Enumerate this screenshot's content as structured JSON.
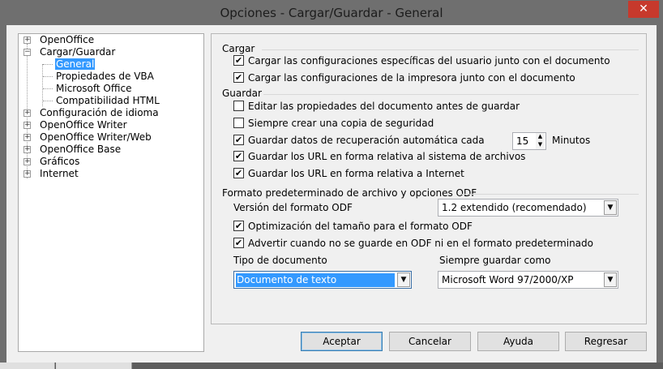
{
  "window": {
    "title": "Opciones - Cargar/Guardar - General",
    "close_glyph": "✕"
  },
  "tree": {
    "items": [
      {
        "label": "OpenOffice",
        "expander": "+"
      },
      {
        "label": "Cargar/Guardar",
        "expander": "−"
      },
      {
        "label": "General"
      },
      {
        "label": "Propiedades de VBA"
      },
      {
        "label": "Microsoft Office"
      },
      {
        "label": "Compatibilidad HTML"
      },
      {
        "label": "Configuración de idioma",
        "expander": "+"
      },
      {
        "label": "OpenOffice Writer",
        "expander": "+"
      },
      {
        "label": "OpenOffice Writer/Web",
        "expander": "+"
      },
      {
        "label": "OpenOffice Base",
        "expander": "+"
      },
      {
        "label": "Gráficos",
        "expander": "+"
      },
      {
        "label": "Internet",
        "expander": "+"
      }
    ],
    "selected": "General"
  },
  "cargar": {
    "title": "Cargar",
    "options": [
      {
        "label": "Cargar las configuraciones específicas del usuario junto con el documento",
        "checked": true
      },
      {
        "label": "Cargar las configuraciones de la impresora junto con el documento",
        "checked": true
      }
    ]
  },
  "guardar": {
    "title": "Guardar",
    "options": [
      {
        "label": "Editar las propiedades del documento antes de guardar",
        "checked": false
      },
      {
        "label": "Siempre crear una copia de seguridad",
        "checked": false
      },
      {
        "label": "Guardar datos de recuperación automática cada",
        "checked": true
      },
      {
        "label": "Guardar los URL en forma relativa al sistema de archivos",
        "checked": true
      },
      {
        "label": "Guardar los URL en forma relativa a Internet",
        "checked": true
      }
    ],
    "autorecovery_value": "15",
    "autorecovery_unit": "Minutos"
  },
  "odf": {
    "title": "Formato predeterminado de archivo y opciones ODF",
    "version_label": "Versión del formato ODF",
    "version_value": "1.2 extendido (recomendado)",
    "options": [
      {
        "label": "Optimización del tamaño para el formato ODF",
        "checked": true
      },
      {
        "label": "Advertir cuando no se guarde en ODF ni en el formato predeterminado",
        "checked": true
      }
    ],
    "doctype_label": "Tipo de documento",
    "doctype_value": "Documento de texto",
    "saveas_label": "Siempre guardar como",
    "saveas_value": "Microsoft Word 97/2000/XP"
  },
  "buttons": {
    "ok": "Aceptar",
    "cancel": "Cancelar",
    "help": "Ayuda",
    "back": "Regresar"
  },
  "glyphs": {
    "check": "✔",
    "dropdown": "▼",
    "spin_up": "▲",
    "spin_down": "▼"
  },
  "colors": {
    "selection": "#3399ff",
    "close": "#c7392c"
  }
}
